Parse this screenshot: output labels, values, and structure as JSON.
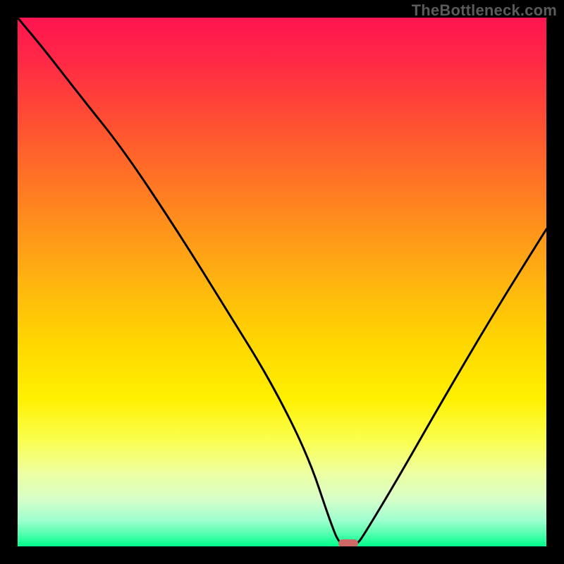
{
  "watermark": "TheBottleneck.com",
  "colors": {
    "background": "#000000",
    "marker": "#d06868",
    "curve_stroke": "#000000",
    "gradient_stops": [
      {
        "offset": 0.0,
        "color": "#ff1450"
      },
      {
        "offset": 0.08,
        "color": "#ff2846"
      },
      {
        "offset": 0.2,
        "color": "#ff5032"
      },
      {
        "offset": 0.35,
        "color": "#ff8220"
      },
      {
        "offset": 0.5,
        "color": "#ffb410"
      },
      {
        "offset": 0.62,
        "color": "#ffd800"
      },
      {
        "offset": 0.72,
        "color": "#fff000"
      },
      {
        "offset": 0.8,
        "color": "#faff50"
      },
      {
        "offset": 0.86,
        "color": "#eeffa0"
      },
      {
        "offset": 0.91,
        "color": "#d8ffc8"
      },
      {
        "offset": 0.95,
        "color": "#a0ffd0"
      },
      {
        "offset": 0.975,
        "color": "#58ffb0"
      },
      {
        "offset": 1.0,
        "color": "#00ff8c"
      }
    ]
  },
  "chart_data": {
    "type": "line",
    "title": "",
    "xlabel": "",
    "ylabel": "",
    "xlim": [
      0,
      100
    ],
    "ylim": [
      0,
      100
    ],
    "grid": false,
    "series": [
      {
        "name": "bottleneck-curve",
        "x": [
          0,
          5,
          12,
          20,
          30,
          40,
          48,
          55,
          59,
          61,
          64,
          66,
          72,
          80,
          90,
          100
        ],
        "values": [
          100,
          94,
          85,
          75,
          60,
          44,
          31,
          17,
          5,
          0,
          0,
          3,
          13,
          27,
          44,
          60
        ]
      }
    ],
    "annotations": [
      {
        "name": "optimal-marker",
        "x": 62.5,
        "y": 0
      }
    ]
  }
}
